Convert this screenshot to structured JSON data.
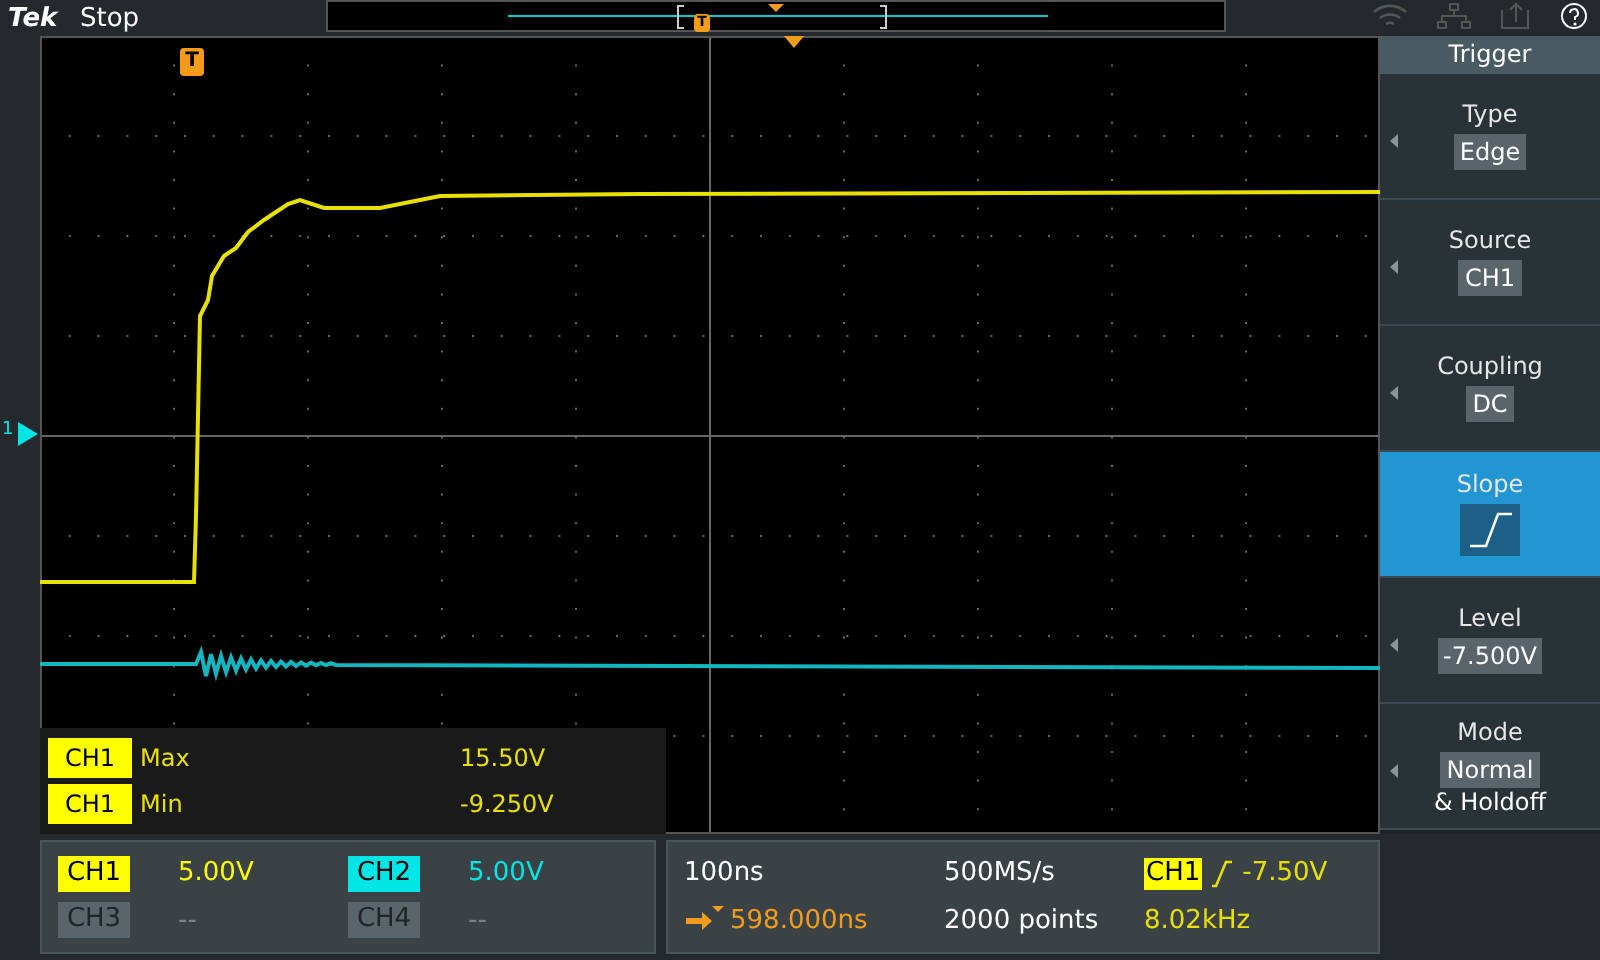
{
  "app": {
    "logo": "Tek",
    "run_state": "Stop"
  },
  "overview": {
    "trigger_marker": "T"
  },
  "plot": {
    "trigger_marker": "T",
    "channel_marker": "1",
    "measurements": [
      {
        "channel": "CH1",
        "name": "Max",
        "value": "15.50V"
      },
      {
        "channel": "CH1",
        "name": "Min",
        "value": "-9.250V"
      }
    ]
  },
  "side_menu": {
    "title": "Trigger",
    "items": [
      {
        "label": "Type",
        "kind": "text",
        "value": "Edge",
        "selected": false
      },
      {
        "label": "Source",
        "kind": "text",
        "value": "CH1",
        "selected": false
      },
      {
        "label": "Coupling",
        "kind": "text",
        "value": "DC",
        "selected": false
      },
      {
        "label": "Slope",
        "kind": "slope",
        "selected": true
      },
      {
        "label": "Level",
        "kind": "text",
        "value": "-7.500V",
        "selected": false
      },
      {
        "label": "Mode",
        "kind": "text",
        "value": "Normal",
        "extra": "& Holdoff",
        "selected": false
      }
    ]
  },
  "channels": [
    {
      "name": "CH1",
      "scale": "5.00V",
      "color": "#ffff00",
      "enabled": true
    },
    {
      "name": "CH2",
      "scale": "5.00V",
      "color": "#00e5e5",
      "enabled": true
    },
    {
      "name": "CH3",
      "scale": "--",
      "color": "#5a646b",
      "enabled": false
    },
    {
      "name": "CH4",
      "scale": "--",
      "color": "#5a646b",
      "enabled": false
    }
  ],
  "horizontal": {
    "scale": "100ns",
    "position": "598.000ns",
    "sample_rate": "500MS/s",
    "record_length": "2000 points"
  },
  "trigger": {
    "source": "CH1",
    "level": "-7.50V",
    "frequency": "8.02kHz"
  }
}
